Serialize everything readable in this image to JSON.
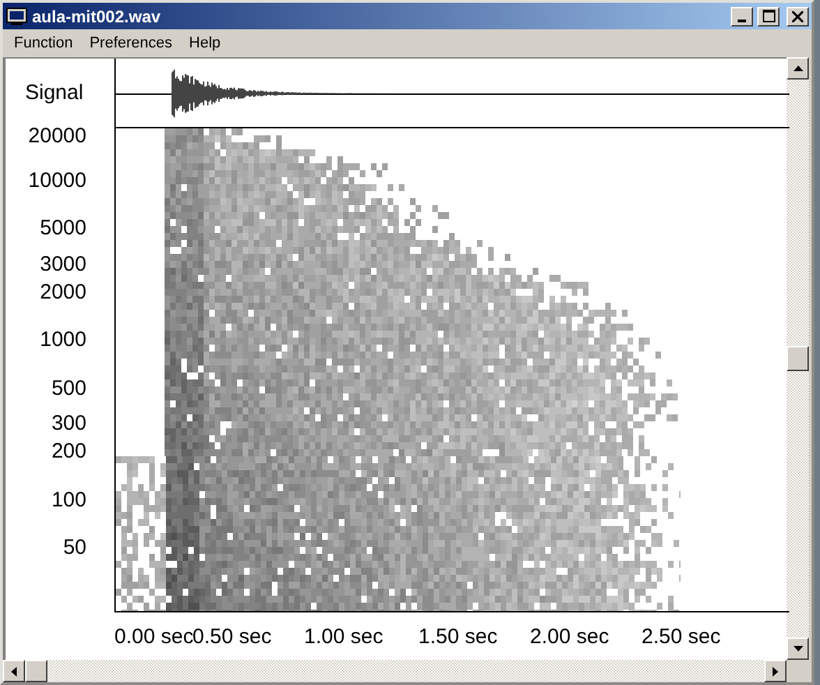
{
  "window": {
    "title": "aula-mit002.wav"
  },
  "menu": [
    "Function",
    "Preferences",
    "Help"
  ],
  "signal_label": "Signal",
  "frequency_labels": [
    "20000",
    "10000",
    "5000",
    "3000",
    "2000",
    "1000",
    "500",
    "300",
    "200",
    "100",
    "50"
  ],
  "time_labels": [
    "0.00 sec",
    "0.50 sec",
    "1.00 sec",
    "1.50 sec",
    "2.00 sec",
    "2.50 sec"
  ]
}
